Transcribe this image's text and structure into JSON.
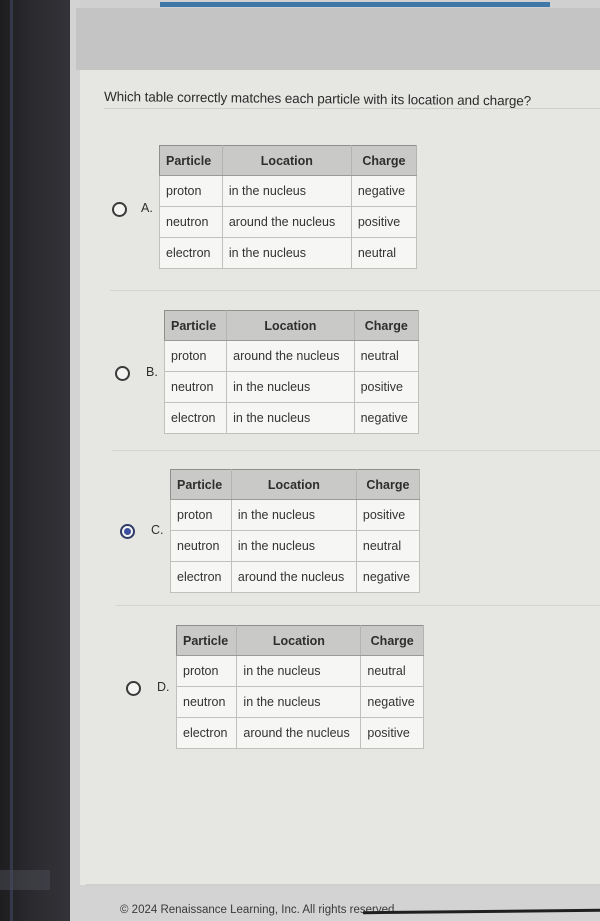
{
  "question": "Which table correctly matches each particle with its location and charge?",
  "table_headers": [
    "Particle",
    "Location",
    "Charge"
  ],
  "options": [
    {
      "letter": "A.",
      "selected": false,
      "rows": [
        [
          "proton",
          "in the nucleus",
          "negative"
        ],
        [
          "neutron",
          "around the nucleus",
          "positive"
        ],
        [
          "electron",
          "in the nucleus",
          "neutral"
        ]
      ]
    },
    {
      "letter": "B.",
      "selected": false,
      "rows": [
        [
          "proton",
          "around the nucleus",
          "neutral"
        ],
        [
          "neutron",
          "in the nucleus",
          "positive"
        ],
        [
          "electron",
          "in the nucleus",
          "negative"
        ]
      ]
    },
    {
      "letter": "C.",
      "selected": true,
      "rows": [
        [
          "proton",
          "in the nucleus",
          "positive"
        ],
        [
          "neutron",
          "in the nucleus",
          "neutral"
        ],
        [
          "electron",
          "around the nucleus",
          "negative"
        ]
      ]
    },
    {
      "letter": "D.",
      "selected": false,
      "rows": [
        [
          "proton",
          "in the nucleus",
          "neutral"
        ],
        [
          "neutron",
          "in the nucleus",
          "negative"
        ],
        [
          "electron",
          "around the nucleus",
          "positive"
        ]
      ]
    }
  ],
  "footer": "© 2024 Renaissance Learning, Inc. All rights reserved.",
  "colors": {
    "selected_radio": "#3c4fa0",
    "top_accent": "#3f78a6"
  }
}
